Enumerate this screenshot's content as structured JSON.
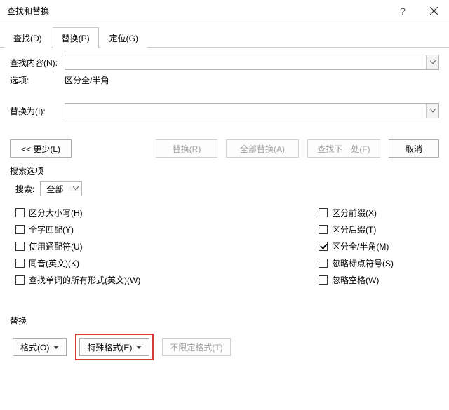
{
  "window": {
    "title": "查找和替换"
  },
  "tabs": {
    "find": "查找(D)",
    "replace": "替换(P)",
    "goto": "定位(G)"
  },
  "fields": {
    "find_label": "查找内容(N):",
    "options_label": "选项:",
    "options_value": "区分全/半角",
    "replace_label": "替换为(I):"
  },
  "buttons": {
    "less": "<< 更少(L)",
    "replace": "替换(R)",
    "replace_all": "全部替换(A)",
    "find_next": "查找下一处(F)",
    "cancel": "取消"
  },
  "search_options": {
    "title": "搜索选项",
    "search_label": "搜索:",
    "search_value": "全部",
    "left": {
      "match_case": "区分大小写(H)",
      "whole_word": "全字匹配(Y)",
      "wildcards": "使用通配符(U)",
      "sounds_like": "同音(英文)(K)",
      "all_forms": "查找单词的所有形式(英文)(W)"
    },
    "right": {
      "prefix": "区分前缀(X)",
      "suffix": "区分后缀(T)",
      "fullhalf": "区分全/半角(M)",
      "ignore_punct": "忽略标点符号(S)",
      "ignore_space": "忽略空格(W)"
    }
  },
  "replace_section": {
    "title": "替换",
    "format": "格式(O)",
    "special": "特殊格式(E)",
    "no_format": "不限定格式(T)"
  }
}
